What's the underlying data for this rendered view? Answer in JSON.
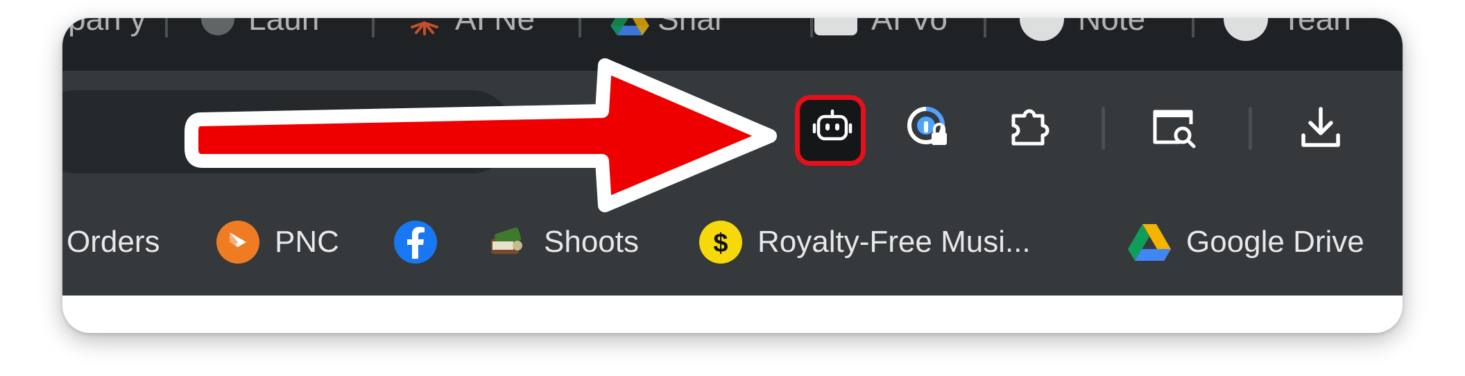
{
  "tabs": [
    {
      "label": "pan y",
      "icon": "tab-favicon",
      "color": "#8a8f93"
    },
    {
      "label": "Laun",
      "icon": "tab-favicon",
      "color": "#8a8f93"
    },
    {
      "label": "AI Ne",
      "icon": "starburst-favicon",
      "color": "#e4572e"
    },
    {
      "label": "Shar",
      "icon": "google-drive-favicon",
      "color": "#4285f4"
    },
    {
      "label": "AI Vo",
      "icon": "app-favicon",
      "color": "#ffffff"
    },
    {
      "label": "Note",
      "icon": "ai-favicon",
      "color": "#ffffff"
    },
    {
      "label": "Tean",
      "icon": "ai-favicon",
      "color": "#ffffff"
    }
  ],
  "toolbar": {
    "icons": [
      "robot-extension-icon",
      "password-lock-icon",
      "extensions-puzzle-icon",
      "page-search-icon",
      "download-icon"
    ],
    "highlight_color": "#e6101a"
  },
  "bookmarks": [
    {
      "label": "Orders"
    },
    {
      "label": "PNC",
      "icon": "pnc-icon",
      "color": "#ef7c22"
    },
    {
      "label": "",
      "icon": "facebook-icon",
      "color": "#1877f2"
    },
    {
      "label": "Shoots",
      "icon": "shoots-icon",
      "color": "#6b8f3a"
    },
    {
      "label": "Royalty-Free Musi...",
      "icon": "dollar-coin-icon",
      "color": "#f5d90a"
    },
    {
      "label": "Google Drive",
      "icon": "google-drive-icon",
      "color": "#4285f4"
    }
  ],
  "annotation": {
    "icon": "pointer-arrow",
    "color": "#ee0000"
  }
}
